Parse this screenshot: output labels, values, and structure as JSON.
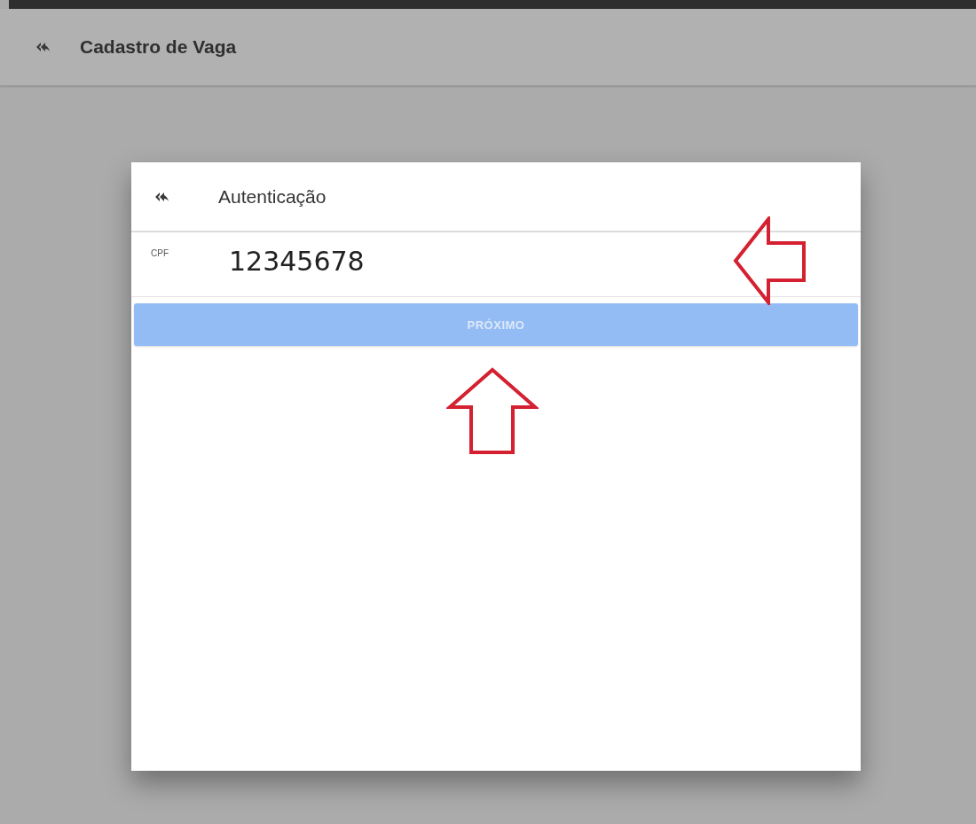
{
  "app_bar": {
    "title": "Cadastro de Vaga"
  },
  "dialog": {
    "title": "Autenticação",
    "cpf_field": {
      "label": "CPF",
      "value": "12345678"
    },
    "next_button": {
      "label": "PRÓXIMO",
      "disabled": true
    }
  }
}
